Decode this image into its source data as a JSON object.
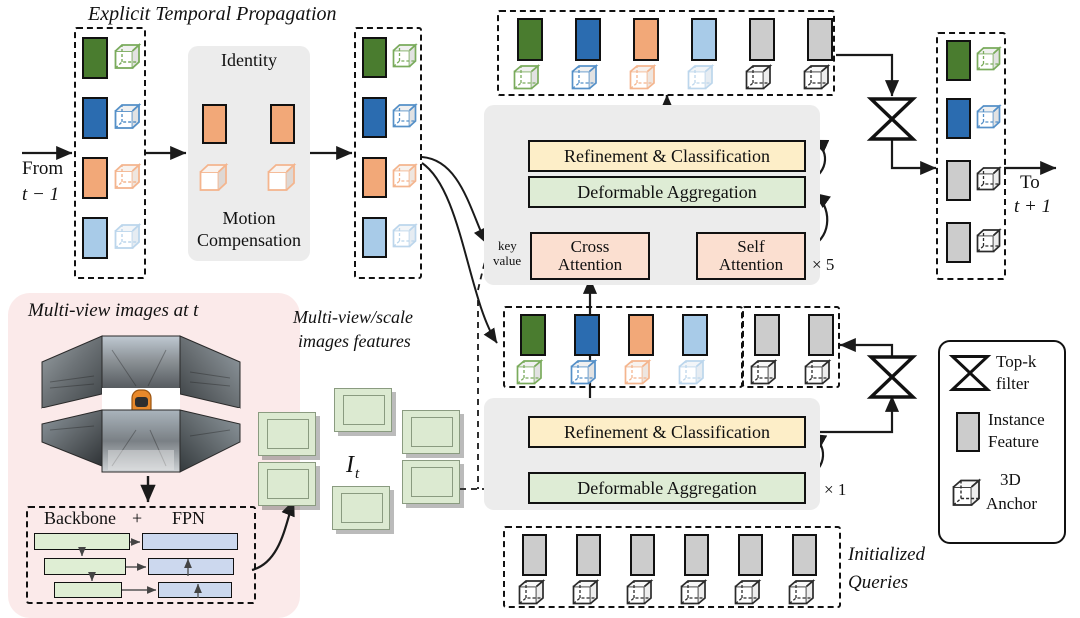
{
  "titles": {
    "etp": "Explicit Temporal Propagation",
    "multiview_images": "Multi-view images at t",
    "multiview_features_l1": "Multi-view/scale",
    "multiview_features_l2": "images features",
    "features_symbol": "I",
    "features_symbol_sub": "t",
    "initialized_queries_l1": "Initialized",
    "initialized_queries_l2": "Queries"
  },
  "flow_labels": {
    "from_l1": "From",
    "from_l2": "t − 1",
    "to_l1": "To",
    "to_l2": "t + 1",
    "key": "key",
    "value": "value"
  },
  "temporal_module": {
    "identity": "Identity",
    "motion_l1": "Motion",
    "motion_l2": "Compensation"
  },
  "backbone": {
    "label_left": "Backbone",
    "label_plus": "+",
    "label_right": "FPN"
  },
  "decoder_top": {
    "refinement": "Refinement & Classification",
    "deformable": "Deformable Aggregation",
    "cross_attention_l1": "Cross",
    "cross_attention_l2": "Attention",
    "self_attention_l1": "Self",
    "self_attention_l2": "Attention",
    "repeat": "× 5"
  },
  "decoder_bottom": {
    "refinement": "Refinement & Classification",
    "deformable": "Deformable Aggregation",
    "repeat": "× 1"
  },
  "legend": {
    "topk_l1": "Top-k",
    "topk_l2": "filter",
    "instance_l1": "Instance",
    "instance_l2": "Feature",
    "anchor_l1": "3D",
    "anchor_l2": "Anchor"
  },
  "colors": {
    "green": "#4a7c2f",
    "blue": "#2b6cb0",
    "orange": "#f2a878",
    "lightblue": "#a8cbe8",
    "gray": "#cccccc",
    "anchor_green": "#7aab5c",
    "anchor_blue": "#5590c8",
    "anchor_orange": "#f4b58e",
    "anchor_lightblue": "#bcd6ec",
    "anchor_gray": "#2b2b2b",
    "refinement_fill": "#fdeec8",
    "deformable_fill": "#deecd5",
    "attention_fill": "#fbdfd0",
    "panel_fill": "#ececec",
    "pink_bg": "#fbeaea",
    "backbone_green": "#dfeed4",
    "fpn_blue": "#ccd8ee",
    "feature_tile": "#dcead1"
  },
  "sets": {
    "prev_frame_features": [
      "green",
      "blue",
      "orange",
      "lightblue"
    ],
    "propagated_features": [
      "green",
      "blue",
      "orange",
      "lightblue"
    ],
    "top_output_features": [
      "green",
      "blue",
      "orange",
      "lightblue",
      "gray",
      "gray"
    ],
    "mid_temporal_features": [
      "green",
      "blue",
      "orange",
      "lightblue"
    ],
    "mid_new_features": [
      "gray",
      "gray"
    ],
    "final_output_features": [
      "green",
      "blue",
      "gray",
      "gray"
    ],
    "initialized_queries": [
      "gray",
      "gray",
      "gray",
      "gray",
      "gray",
      "gray"
    ]
  }
}
